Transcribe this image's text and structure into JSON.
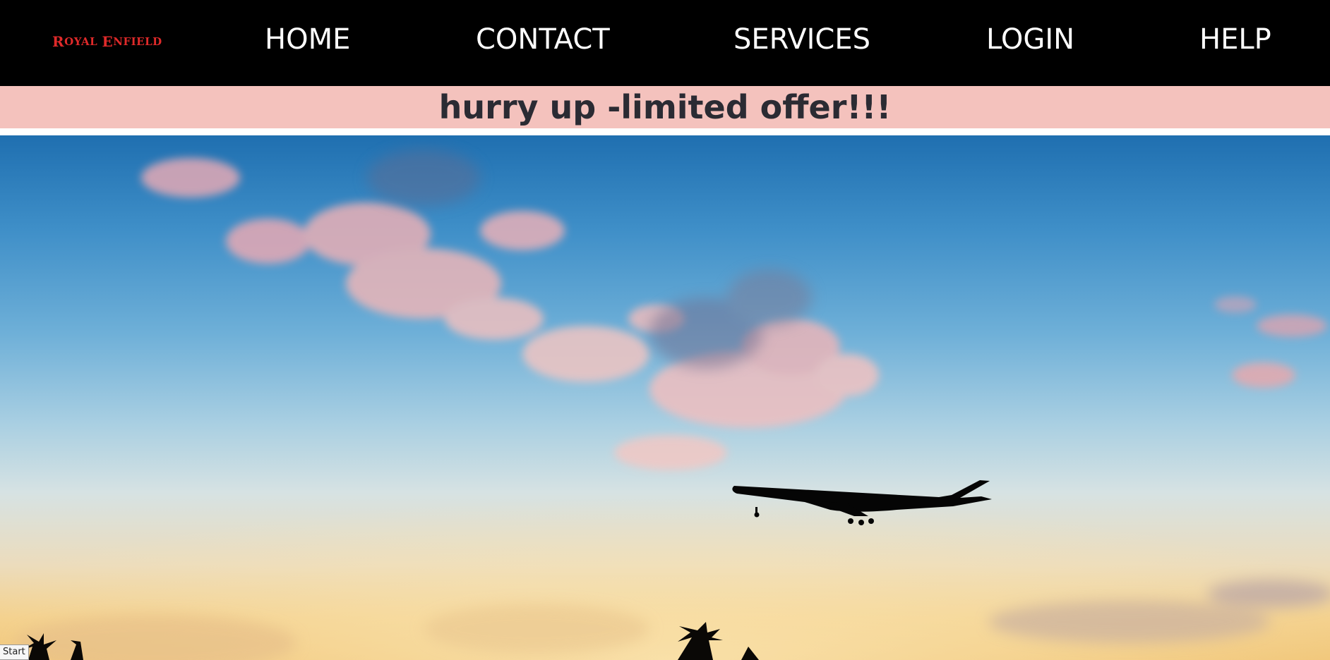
{
  "navbar": {
    "logo": {
      "first_cap": "R",
      "first_rest": "OYAL",
      "second_cap": "E",
      "second_rest": "NFIELD"
    },
    "links": [
      "HOME",
      "CONTACT",
      "SERVICES",
      "LOGIN",
      "HELP"
    ]
  },
  "banner": {
    "text": "hurry up -limited offer!!!"
  },
  "hero": {
    "image_alt": "airplane silhouette against sunset sky"
  },
  "start_button": {
    "label": "Start"
  },
  "colors": {
    "navbar_bg": "#000000",
    "logo": "#e02a2a",
    "banner_bg": "#f4c2bd",
    "banner_text": "#2b2b33"
  }
}
